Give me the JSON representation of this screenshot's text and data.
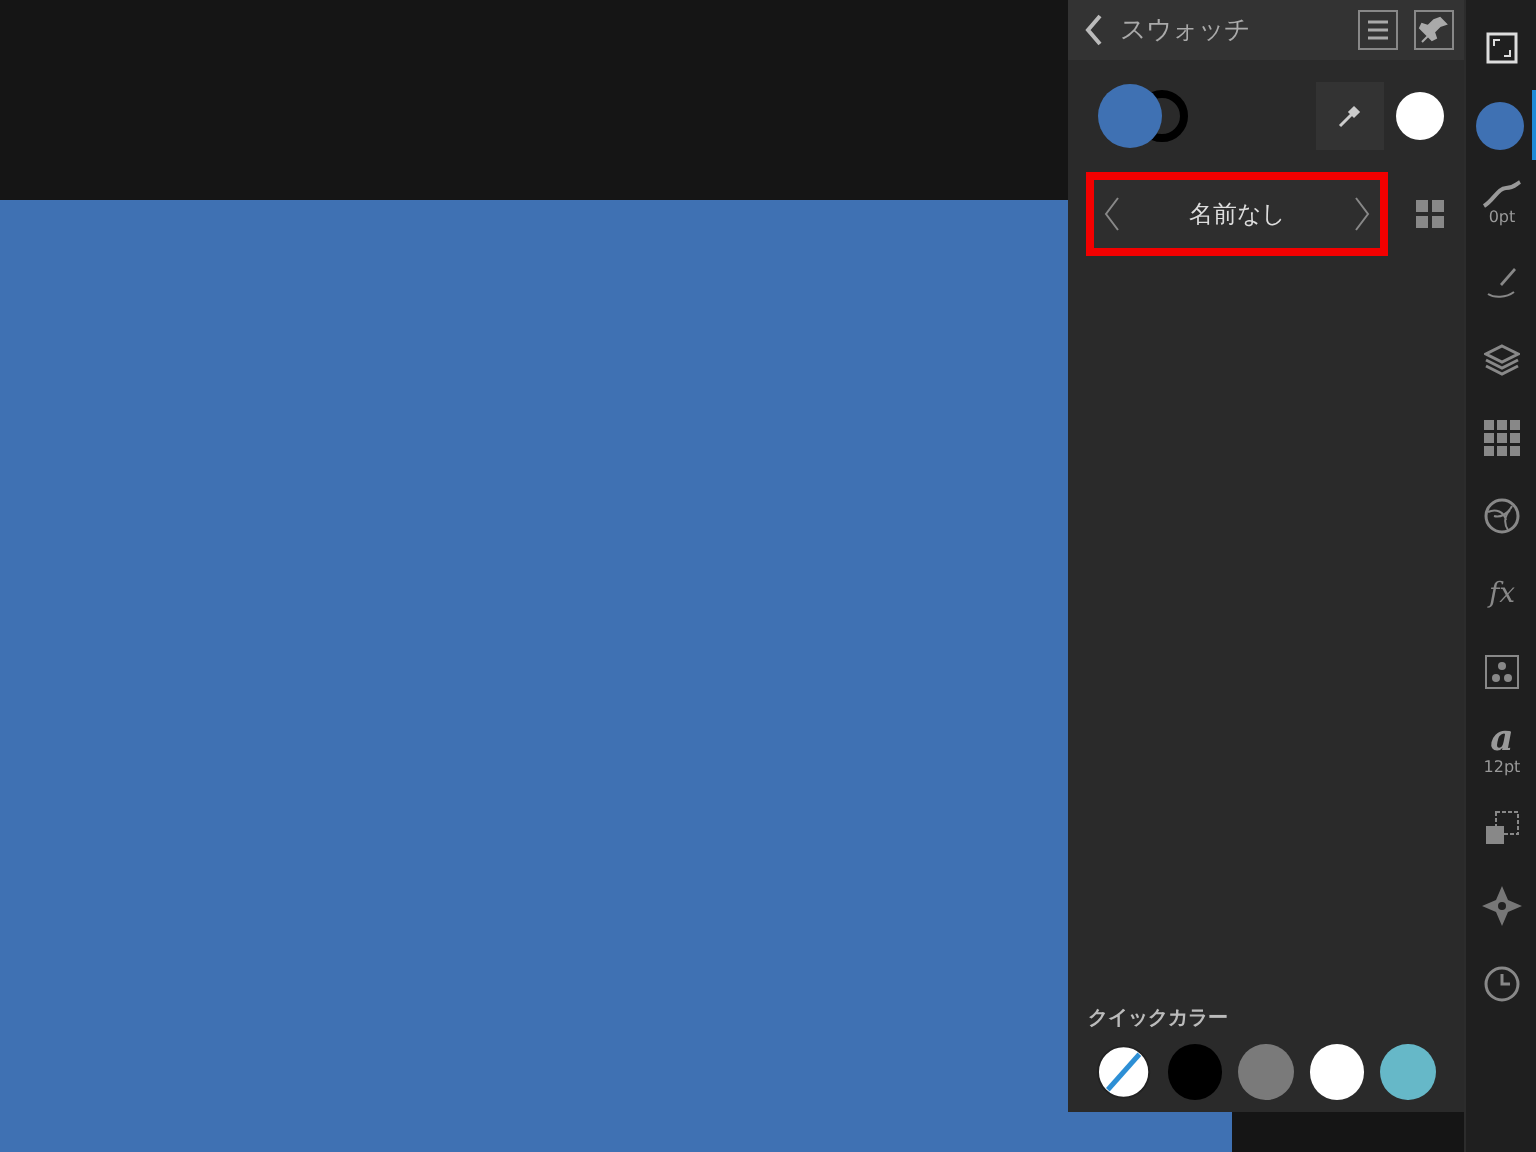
{
  "panel": {
    "title": "スウォッチ",
    "swatch_set": {
      "name": "名前なし",
      "highlighted": true
    },
    "quick_colors_label": "クイックカラー",
    "quick_colors": [
      {
        "kind": "none",
        "color": "#ffffff"
      },
      {
        "kind": "solid",
        "color": "#000000"
      },
      {
        "kind": "solid",
        "color": "#7a7a7a"
      },
      {
        "kind": "solid",
        "color": "#ffffff"
      },
      {
        "kind": "solid",
        "color": "#66b8c8"
      }
    ]
  },
  "toolbar": [
    {
      "kind": "frame",
      "selected": false
    },
    {
      "kind": "fill",
      "selected": true
    },
    {
      "kind": "stroke",
      "label": "0pt",
      "selected": false
    },
    {
      "kind": "brush",
      "selected": false
    },
    {
      "kind": "layers",
      "selected": false
    },
    {
      "kind": "grid",
      "selected": false
    },
    {
      "kind": "aperture",
      "selected": false
    },
    {
      "kind": "fx",
      "label": "fx",
      "selected": false
    },
    {
      "kind": "styles",
      "selected": false
    },
    {
      "kind": "text",
      "label": "a",
      "sublabel": "12pt",
      "selected": false
    },
    {
      "kind": "transform",
      "selected": false
    },
    {
      "kind": "navigator",
      "selected": false
    },
    {
      "kind": "history",
      "selected": false
    }
  ]
}
